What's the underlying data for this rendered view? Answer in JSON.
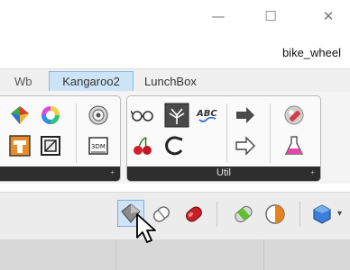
{
  "window": {
    "minimize_glyph": "—",
    "maximize_glyph": "☐",
    "close_glyph": "✕"
  },
  "document": {
    "title": "bike_wheel"
  },
  "tabs": [
    {
      "label": "Wb"
    },
    {
      "label": "Kangaroo2",
      "active": true
    },
    {
      "label": "LunchBox"
    }
  ],
  "ribbon": {
    "panels": [
      {
        "label": "",
        "icons": [
          "gem-icon",
          "color-wheel-icon",
          "target-icon",
          "tape-icon",
          "frame-icon",
          "3dm-icon"
        ]
      },
      {
        "label": "Util",
        "icons": [
          "glasses-icon",
          "tree-icon",
          "abc-spell-icon",
          "arrow-right-filled-icon",
          "pill-icon",
          "cherries-icon",
          "ring-icon",
          "arrow-right-outline-icon",
          "flask-icon"
        ]
      }
    ],
    "expand_glyph": "+"
  },
  "toolbar": {
    "icons": [
      "preview-selected-icon",
      "wireframe-icon",
      "shaded-icon",
      "bake-icon",
      "half-sphere-icon",
      "sphere-dropdown-icon"
    ],
    "dropdown_glyph": "▾"
  },
  "colors": {
    "active_tab_bg": "#cde4f7",
    "panel_strip": "#2d2d2d",
    "selected_tool_bg": "#cfe3f6"
  }
}
